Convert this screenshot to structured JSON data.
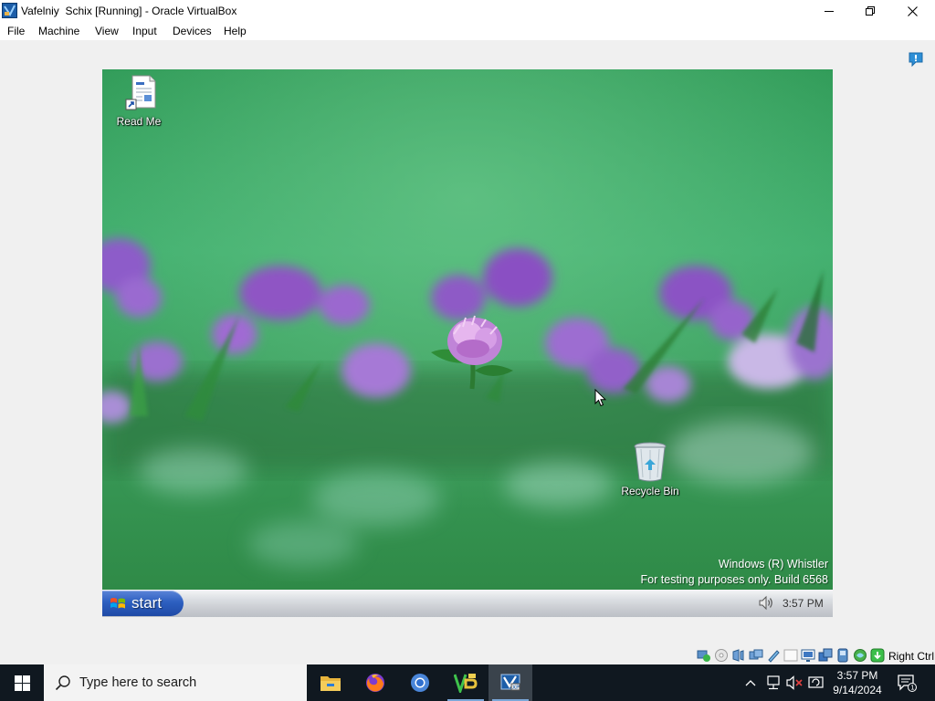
{
  "window": {
    "title": "Vafelniy  Schix [Running] - Oracle VirtualBox",
    "minimize_icon": "minimize-icon",
    "restore_icon": "restore-icon",
    "close_icon": "close-icon"
  },
  "menu": {
    "items": [
      {
        "label": "File"
      },
      {
        "label": "Machine"
      },
      {
        "label": "View"
      },
      {
        "label": "Input"
      },
      {
        "label": "Devices"
      },
      {
        "label": "Help"
      }
    ]
  },
  "guest": {
    "desktop_icons": [
      {
        "label": "Read Me",
        "icon": "document-shortcut-icon"
      },
      {
        "label": "Recycle Bin",
        "icon": "recycle-bin-icon"
      }
    ],
    "watermark": {
      "line1": "Windows (R) Whistler",
      "line2": "For testing purposes only. Build 6568"
    },
    "taskbar": {
      "start_label": "start",
      "clock": "3:57 PM"
    }
  },
  "statusbar": {
    "host_key": "Right Ctrl",
    "icons": [
      "network-icon",
      "optical-drive-icon",
      "audio-icon",
      "usb-icon",
      "shared-folders-icon",
      "display-icon",
      "recording-icon",
      "mouse-integration-icon",
      "keyboard-icon",
      "cpu-icon",
      "arrow-status-icon",
      "info-icon"
    ]
  },
  "host_taskbar": {
    "search_placeholder": "Type here to search",
    "apps": [
      "file-explorer-icon",
      "firefox-icon",
      "chrome-icon",
      "virtualbox-manager-icon",
      "virtualbox-vm-icon"
    ],
    "clock": {
      "time": "3:57 PM",
      "date": "9/14/2024"
    },
    "notification_count": "1"
  },
  "colors": {
    "host_taskbar": "#101820",
    "xp_start": "#2d5fc0",
    "accent_indicator": "#7aa7d8"
  }
}
